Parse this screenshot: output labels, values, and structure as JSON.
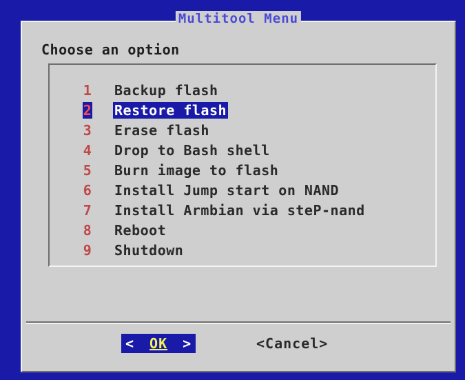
{
  "dialog": {
    "title": "Multitool Menu",
    "prompt": "Choose an option"
  },
  "menu": {
    "items": [
      {
        "num": "1",
        "label": "Backup flash",
        "selected": false
      },
      {
        "num": "2",
        "label": "Restore flash",
        "selected": true
      },
      {
        "num": "3",
        "label": "Erase flash",
        "selected": false
      },
      {
        "num": "4",
        "label": "Drop to Bash shell",
        "selected": false
      },
      {
        "num": "5",
        "label": "Burn image to flash",
        "selected": false
      },
      {
        "num": "6",
        "label": "Install Jump start on NAND",
        "selected": false
      },
      {
        "num": "7",
        "label": "Install Armbian via steP-nand",
        "selected": false
      },
      {
        "num": "8",
        "label": "Reboot",
        "selected": false
      },
      {
        "num": "9",
        "label": "Shutdown",
        "selected": false
      }
    ]
  },
  "buttons": {
    "ok_left": "<",
    "ok_label": "OK",
    "ok_right": ">",
    "cancel_label": "<Cancel>"
  },
  "colors": {
    "screen_bg": "#1a1aa8",
    "dialog_bg": "#cfcfcf",
    "highlight_bg": "#1a1aa8",
    "item_number": "#c04848",
    "title_text": "#4a4ad6"
  }
}
